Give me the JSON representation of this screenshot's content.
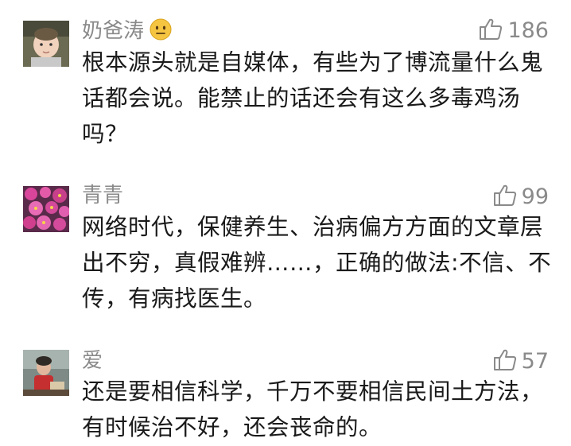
{
  "comments": [
    {
      "username": "奶爸涛",
      "has_emoji": true,
      "emoji_icon": "smiling-face-emoji",
      "likes": "186",
      "content_lines": [
        "根本源头就是自媒体，有些为了博流量什么鬼",
        "话都会说。能禁止的话还会有这么多毒鸡汤",
        "吗？"
      ],
      "avatar_icon": "baby-photo-avatar"
    },
    {
      "username": "青青",
      "has_emoji": false,
      "likes": "99",
      "content_lines": [
        "网络时代，保健养生、治病偏方方面的文章层",
        "出不穷，真假难辨……，正确的做法:不信、不",
        "传，有病找医生。"
      ],
      "avatar_icon": "pink-flowers-avatar"
    },
    {
      "username": "爱",
      "has_emoji": false,
      "likes": "57",
      "content_lines": [
        "还是要相信科学，千万不要相信民间土方法，",
        "有时候治不好，还会丧命的。"
      ],
      "avatar_icon": "child-photo-avatar"
    }
  ],
  "colors": {
    "username": "#8a8a8a",
    "content": "#1a1a1a",
    "like_icon": "#8a8a8a",
    "emoji_face": "#f5c542"
  }
}
